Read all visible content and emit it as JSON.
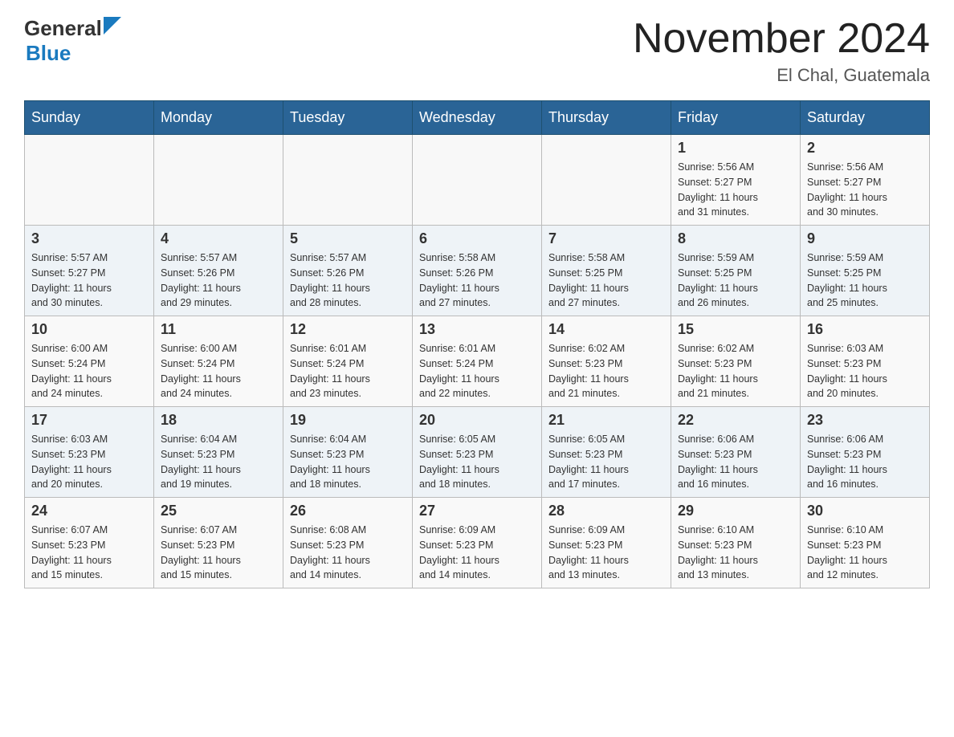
{
  "header": {
    "logo_general": "General",
    "logo_blue": "Blue",
    "month_title": "November 2024",
    "location": "El Chal, Guatemala"
  },
  "days_of_week": [
    "Sunday",
    "Monday",
    "Tuesday",
    "Wednesday",
    "Thursday",
    "Friday",
    "Saturday"
  ],
  "weeks": [
    {
      "days": [
        {
          "num": "",
          "info": ""
        },
        {
          "num": "",
          "info": ""
        },
        {
          "num": "",
          "info": ""
        },
        {
          "num": "",
          "info": ""
        },
        {
          "num": "",
          "info": ""
        },
        {
          "num": "1",
          "info": "Sunrise: 5:56 AM\nSunset: 5:27 PM\nDaylight: 11 hours\nand 31 minutes."
        },
        {
          "num": "2",
          "info": "Sunrise: 5:56 AM\nSunset: 5:27 PM\nDaylight: 11 hours\nand 30 minutes."
        }
      ]
    },
    {
      "days": [
        {
          "num": "3",
          "info": "Sunrise: 5:57 AM\nSunset: 5:27 PM\nDaylight: 11 hours\nand 30 minutes."
        },
        {
          "num": "4",
          "info": "Sunrise: 5:57 AM\nSunset: 5:26 PM\nDaylight: 11 hours\nand 29 minutes."
        },
        {
          "num": "5",
          "info": "Sunrise: 5:57 AM\nSunset: 5:26 PM\nDaylight: 11 hours\nand 28 minutes."
        },
        {
          "num": "6",
          "info": "Sunrise: 5:58 AM\nSunset: 5:26 PM\nDaylight: 11 hours\nand 27 minutes."
        },
        {
          "num": "7",
          "info": "Sunrise: 5:58 AM\nSunset: 5:25 PM\nDaylight: 11 hours\nand 27 minutes."
        },
        {
          "num": "8",
          "info": "Sunrise: 5:59 AM\nSunset: 5:25 PM\nDaylight: 11 hours\nand 26 minutes."
        },
        {
          "num": "9",
          "info": "Sunrise: 5:59 AM\nSunset: 5:25 PM\nDaylight: 11 hours\nand 25 minutes."
        }
      ]
    },
    {
      "days": [
        {
          "num": "10",
          "info": "Sunrise: 6:00 AM\nSunset: 5:24 PM\nDaylight: 11 hours\nand 24 minutes."
        },
        {
          "num": "11",
          "info": "Sunrise: 6:00 AM\nSunset: 5:24 PM\nDaylight: 11 hours\nand 24 minutes."
        },
        {
          "num": "12",
          "info": "Sunrise: 6:01 AM\nSunset: 5:24 PM\nDaylight: 11 hours\nand 23 minutes."
        },
        {
          "num": "13",
          "info": "Sunrise: 6:01 AM\nSunset: 5:24 PM\nDaylight: 11 hours\nand 22 minutes."
        },
        {
          "num": "14",
          "info": "Sunrise: 6:02 AM\nSunset: 5:23 PM\nDaylight: 11 hours\nand 21 minutes."
        },
        {
          "num": "15",
          "info": "Sunrise: 6:02 AM\nSunset: 5:23 PM\nDaylight: 11 hours\nand 21 minutes."
        },
        {
          "num": "16",
          "info": "Sunrise: 6:03 AM\nSunset: 5:23 PM\nDaylight: 11 hours\nand 20 minutes."
        }
      ]
    },
    {
      "days": [
        {
          "num": "17",
          "info": "Sunrise: 6:03 AM\nSunset: 5:23 PM\nDaylight: 11 hours\nand 20 minutes."
        },
        {
          "num": "18",
          "info": "Sunrise: 6:04 AM\nSunset: 5:23 PM\nDaylight: 11 hours\nand 19 minutes."
        },
        {
          "num": "19",
          "info": "Sunrise: 6:04 AM\nSunset: 5:23 PM\nDaylight: 11 hours\nand 18 minutes."
        },
        {
          "num": "20",
          "info": "Sunrise: 6:05 AM\nSunset: 5:23 PM\nDaylight: 11 hours\nand 18 minutes."
        },
        {
          "num": "21",
          "info": "Sunrise: 6:05 AM\nSunset: 5:23 PM\nDaylight: 11 hours\nand 17 minutes."
        },
        {
          "num": "22",
          "info": "Sunrise: 6:06 AM\nSunset: 5:23 PM\nDaylight: 11 hours\nand 16 minutes."
        },
        {
          "num": "23",
          "info": "Sunrise: 6:06 AM\nSunset: 5:23 PM\nDaylight: 11 hours\nand 16 minutes."
        }
      ]
    },
    {
      "days": [
        {
          "num": "24",
          "info": "Sunrise: 6:07 AM\nSunset: 5:23 PM\nDaylight: 11 hours\nand 15 minutes."
        },
        {
          "num": "25",
          "info": "Sunrise: 6:07 AM\nSunset: 5:23 PM\nDaylight: 11 hours\nand 15 minutes."
        },
        {
          "num": "26",
          "info": "Sunrise: 6:08 AM\nSunset: 5:23 PM\nDaylight: 11 hours\nand 14 minutes."
        },
        {
          "num": "27",
          "info": "Sunrise: 6:09 AM\nSunset: 5:23 PM\nDaylight: 11 hours\nand 14 minutes."
        },
        {
          "num": "28",
          "info": "Sunrise: 6:09 AM\nSunset: 5:23 PM\nDaylight: 11 hours\nand 13 minutes."
        },
        {
          "num": "29",
          "info": "Sunrise: 6:10 AM\nSunset: 5:23 PM\nDaylight: 11 hours\nand 13 minutes."
        },
        {
          "num": "30",
          "info": "Sunrise: 6:10 AM\nSunset: 5:23 PM\nDaylight: 11 hours\nand 12 minutes."
        }
      ]
    }
  ]
}
